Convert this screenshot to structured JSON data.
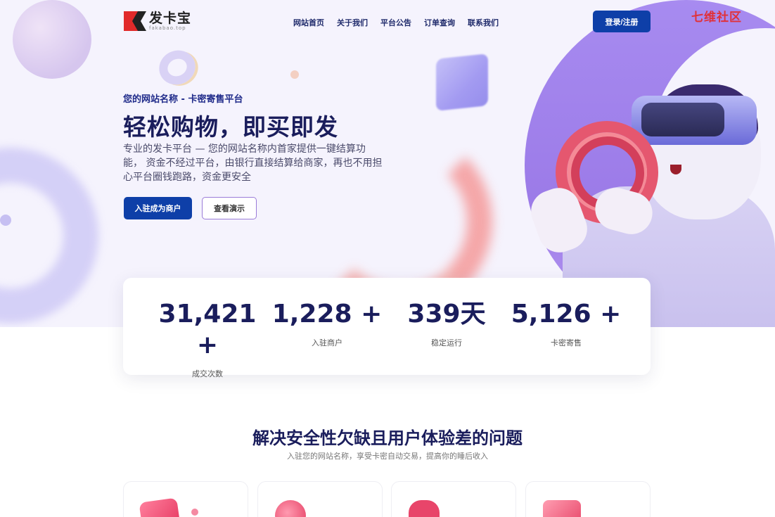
{
  "brand": {
    "name": "发卡宝",
    "domain": "fakabao.top"
  },
  "nav": {
    "items": [
      "网站首页",
      "关于我们",
      "平台公告",
      "订单查询",
      "联系我们"
    ]
  },
  "header": {
    "login_label": "登录/注册",
    "watermark": "七维社区"
  },
  "hero": {
    "subtitle": "您的网站名称 - 卡密寄售平台",
    "title": "轻松购物，即买即发",
    "description": "专业的发卡平台 — 您的网站名称内首家提供一键结算功能， 资金不经过平台，由银行直接结算给商家，再也不用担心平台圈钱跑路，资金更安全",
    "primary_btn": "入驻成为商户",
    "secondary_btn": "查看演示"
  },
  "stats": [
    {
      "value": "31,421 +",
      "label": "成交次数"
    },
    {
      "value": "1,228 +",
      "label": "入驻商户"
    },
    {
      "value": "339天",
      "label": "稳定运行"
    },
    {
      "value": "5,126 +",
      "label": "卡密寄售"
    }
  ],
  "section": {
    "title": "解决安全性欠缺且用户体验差的问题",
    "subtitle": "入驻您的网站名称，享受卡密自动交易，提高你的睡后收入"
  },
  "colors": {
    "primary": "#0e3fa8",
    "accent_purple": "#a78bf0",
    "dark_text": "#1a1d5c",
    "watermark": "#e0313a"
  }
}
